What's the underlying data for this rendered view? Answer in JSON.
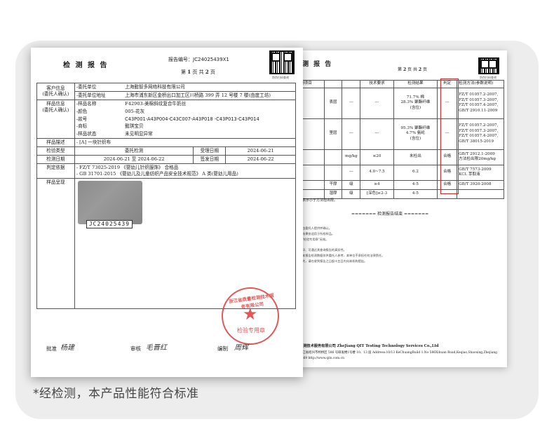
{
  "caption": "*经检测，本产品性能符合标准",
  "front": {
    "title": "检 测 报 告",
    "report_no_label": "报告编号：",
    "report_no": "JC24025439X1",
    "page_prefix": "第",
    "page_current": "1",
    "page_mid": "页 共",
    "page_total": "2",
    "page_suffix": "页",
    "qr_caption": "防伪扫码查询",
    "client_label": "客户信息\n(委托人确认)",
    "client_rows": [
      {
        "k": "-委托单位",
        "v": "上海懿智多网络科技有限公司"
      },
      {
        "k": "-委托单位地址",
        "v": "上海市浦东新区金桥出口加工区川桥路 399 弄 12 号楼 7 楼(由度工坊)"
      }
    ],
    "sample_label": "样品信息\n(委托人确认)",
    "sample_rows": [
      {
        "k": "-样品名称",
        "v": "F42903-美棉斜纹复合牛奶丝"
      },
      {
        "k": "-颜色",
        "v": "005-花灰"
      },
      {
        "k": "-款号",
        "v": "C43P001-A43P004-C43C007-A43P018 -C43P013-C43P014"
      },
      {
        "k": "-商标",
        "v": "懿琪宝贝"
      },
      {
        "k": "-样品状态",
        "v": "未见明显异常"
      }
    ],
    "desc_label": "样品描述",
    "desc_value": "- [A] 一块针织布",
    "type_label": "检验类型",
    "type_value": "委托检测",
    "accept_label": "受理日期",
    "accept_value": "2024-06-21",
    "test_date_label": "检测日期",
    "test_date_value": "2024-06-21 至 2024-06-22",
    "issue_label": "签发日期",
    "issue_value": "2024-06-22",
    "basis_label": "判定依据",
    "basis_lines": [
      "- FZ/T 73025-2019 《婴幼儿针织服饰》 合格品",
      "- GB 31701-2015 《婴幼儿及儿童纺织产品安全技术规范》 A 类(婴幼儿用品)"
    ],
    "photo_label": "样品呈现",
    "photo_tag": "JC24025439",
    "stamp_arc": "浙江省质量检测技术服务有限公司",
    "stamp_label": "检验专用章",
    "approve_label": "批准",
    "review_label": "审核",
    "edit_label": "编制",
    "approve_sig": "杨建",
    "review_sig": "毛晋红",
    "edit_sig": "周辉"
  },
  "back": {
    "title": "测 报 告",
    "page_prefix": "第",
    "page_current": "2",
    "page_mid": "页 共",
    "page_total": "2",
    "page_suffix": "页",
    "qr_caption": "防伪扫码查询",
    "headers": [
      "测项目",
      "",
      "技术要求",
      "检测结果",
      "判定",
      "检测方法(参数说明)"
    ],
    "rows": [
      {
        "item": "表层",
        "unit": "---",
        "req": "---",
        "res": "71.7% 棉\n28.3% 聚酯纤维\n(含位)",
        "judge": "---",
        "method": "FZ/T 01057.2-2007,\nFZ/T 01057.3-2007,\nFZ/T 01057.4-2007,\nGB/T 2910.11-2009"
      },
      {
        "item": "里层",
        "unit": "---",
        "req": "---",
        "res": "95.3% 聚酯纤维\n4.7% 氨纶\n(含位)",
        "judge": "---",
        "method": "FZ/T 01057.2-2007,\nFZ/T 01057.3-2007,\nFZ/T 01057.4-2007,\nGB/T 38015-2019"
      },
      {
        "item": "",
        "unit": "mg/kg",
        "req": "≤20",
        "res": "未检出",
        "judge": "合格",
        "method": "GB/T 2912.1-2009\n方法检出限20mg/kg"
      },
      {
        "item": "",
        "unit": "---",
        "req": "4.0~7.5",
        "res": "6.2",
        "judge": "合格",
        "method": "GB/T 7573-2009\nKCL 萃取液"
      },
      {
        "item": "干摩",
        "unit": "级",
        "req": "≥4",
        "res": "4-5",
        "judge": "合格",
        "method": "GB/T 3920-2008"
      },
      {
        "item": "湿摩",
        "unit": "级",
        "req": "[深色]≥2-3",
        "res": "4-5",
        "judge": "",
        "method": ""
      }
    ],
    "footnote": "表示小于方法检出限。",
    "end_text": "======= 检测报告结束 =======",
    "notes": [
      "由委托人提供并确认。",
      "结果仅适用于所检样品。",
      "\"检验专用章\"无效。",
      "印、可通过其查询报告的真实性。",
      "本报告检测数据仅供委托人参考，本单位不承担任何法律责任。",
      "的，请在收到报告之日起十五日内向本机构提出。"
    ],
    "company": "检测技术服务有限公司  ZheJiang QIT Testing Technology Services Co.,Ltd",
    "address": "浙江省绍兴市柯桥区 586 号研发楼1号楼 10、13 层  Address:10/13 KeChuangBuild 1.No 586Xihuan Road,Keqiao,Shaoxing,Zhejiang",
    "contact": "0669    http://www.qits.com.cn"
  }
}
